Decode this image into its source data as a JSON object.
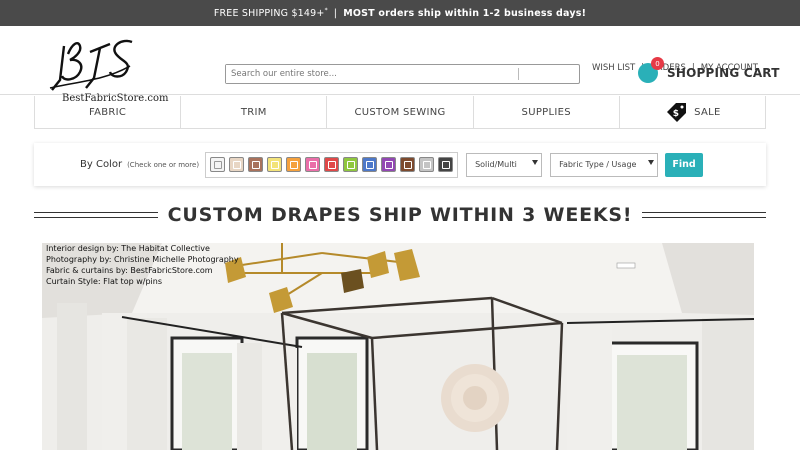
{
  "promo": {
    "text_main": "FREE SHIPPING $149+",
    "text_sup": "*",
    "separator": "|",
    "text_bold": "MOST orders ship within 1-2 business days!"
  },
  "header": {
    "logo_text": "BestFabricStore.com",
    "search_placeholder": "Search our entire store...",
    "account_links": [
      "WISH LIST",
      "ORDERS",
      "MY ACCOUNT"
    ],
    "account_separator": "|",
    "cart_count": "0",
    "cart_label": "SHOPPING CART"
  },
  "nav": {
    "items": [
      "FABRIC",
      "TRIM",
      "CUSTOM SEWING",
      "SUPPLIES",
      "SALE"
    ],
    "sale_tag_symbol": "$"
  },
  "filter": {
    "label": "By Color",
    "hint": "(Check one or more)",
    "swatches": [
      "#f4f4f4",
      "#e8d6c4",
      "#a9725c",
      "#f3e37a",
      "#f5a13d",
      "#ea6ea8",
      "#e04848",
      "#8fc73e",
      "#4d78c9",
      "#9247b3",
      "#7d4a2e",
      "#c4c4c4",
      "#444444"
    ],
    "select_pattern": "Solid/Multi",
    "select_type": "Fabric Type / Usage",
    "find_label": "Find"
  },
  "banner": {
    "title": "CUSTOM DRAPES SHIP WITHIN 3 WEEKS!"
  },
  "hero": {
    "credits": [
      "Interior design by: The Habitat Collective",
      "Photography by: Christine Michelle Photography",
      "Fabric & curtains by: BestFabricStore.com",
      "Curtain Style: Flat top w/pins"
    ]
  },
  "colors": {
    "promo_bg": "#4a4a4a",
    "accent": "#2ab0b8",
    "cart_badge": "#e63946"
  }
}
